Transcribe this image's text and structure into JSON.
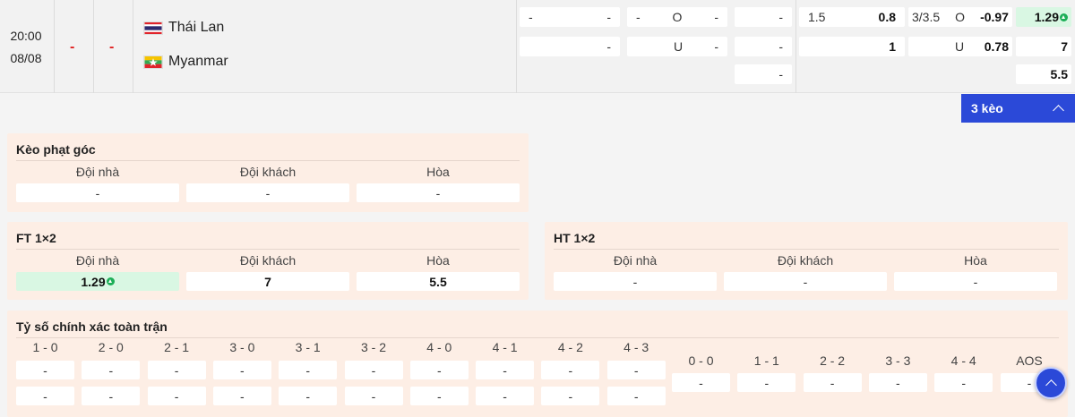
{
  "match": {
    "time": "20:00",
    "date": "08/08",
    "score_home": "-",
    "score_away": "-",
    "home_team": "Thái Lan",
    "away_team": "Myanmar",
    "odds_row1": {
      "hcap_line": "-",
      "hcap_val": "-",
      "ou_line": "-",
      "ou_side": "O",
      "ou_val": "-",
      "x12": "-",
      "ht_hcap_line": "1.5",
      "ht_hcap_val": "0.8",
      "ht_ou_line": "3/3.5",
      "ht_ou_side": "O",
      "ht_ou_val": "-0.97",
      "ht_1x2": "1.29"
    },
    "odds_row2": {
      "hcap_val": "-",
      "ou_side": "U",
      "ou_val": "-",
      "x12": "-",
      "ht_hcap_val": "1",
      "ht_ou_side": "U",
      "ht_ou_val": "0.78",
      "ht_1x2": "7"
    },
    "odds_row3": {
      "x12": "-",
      "ht_1x2": "5.5"
    }
  },
  "more_button": {
    "label": "3 kèo"
  },
  "corner_panel": {
    "title": "Kèo phạt góc",
    "headers": [
      "Đội nhà",
      "Đội khách",
      "Hòa"
    ],
    "values": [
      "-",
      "-",
      "-"
    ]
  },
  "ft_panel": {
    "title": "FT 1×2",
    "headers": [
      "Đội nhà",
      "Đội khách",
      "Hòa"
    ],
    "values": [
      "1.29",
      "7",
      "5.5"
    ]
  },
  "ht_panel": {
    "title": "HT 1×2",
    "headers": [
      "Đội nhà",
      "Đội khách",
      "Hòa"
    ],
    "values": [
      "-",
      "-",
      "-"
    ]
  },
  "cs_panel": {
    "title": "Tỷ số chính xác toàn trận",
    "home_scores": [
      "1 - 0",
      "2 - 0",
      "2 - 1",
      "3 - 0",
      "3 - 1",
      "3 - 2",
      "4 - 0",
      "4 - 1",
      "4 - 2",
      "4 - 3"
    ],
    "home_row1": [
      "-",
      "-",
      "-",
      "-",
      "-",
      "-",
      "-",
      "-",
      "-",
      "-"
    ],
    "home_row2": [
      "-",
      "-",
      "-",
      "-",
      "-",
      "-",
      "-",
      "-",
      "-",
      "-"
    ],
    "draw_scores": [
      "0 - 0",
      "1 - 1",
      "2 - 2",
      "3 - 3",
      "4 - 4",
      "AOS"
    ],
    "draw_row": [
      "-",
      "-",
      "-",
      "-",
      "-",
      "-"
    ]
  }
}
